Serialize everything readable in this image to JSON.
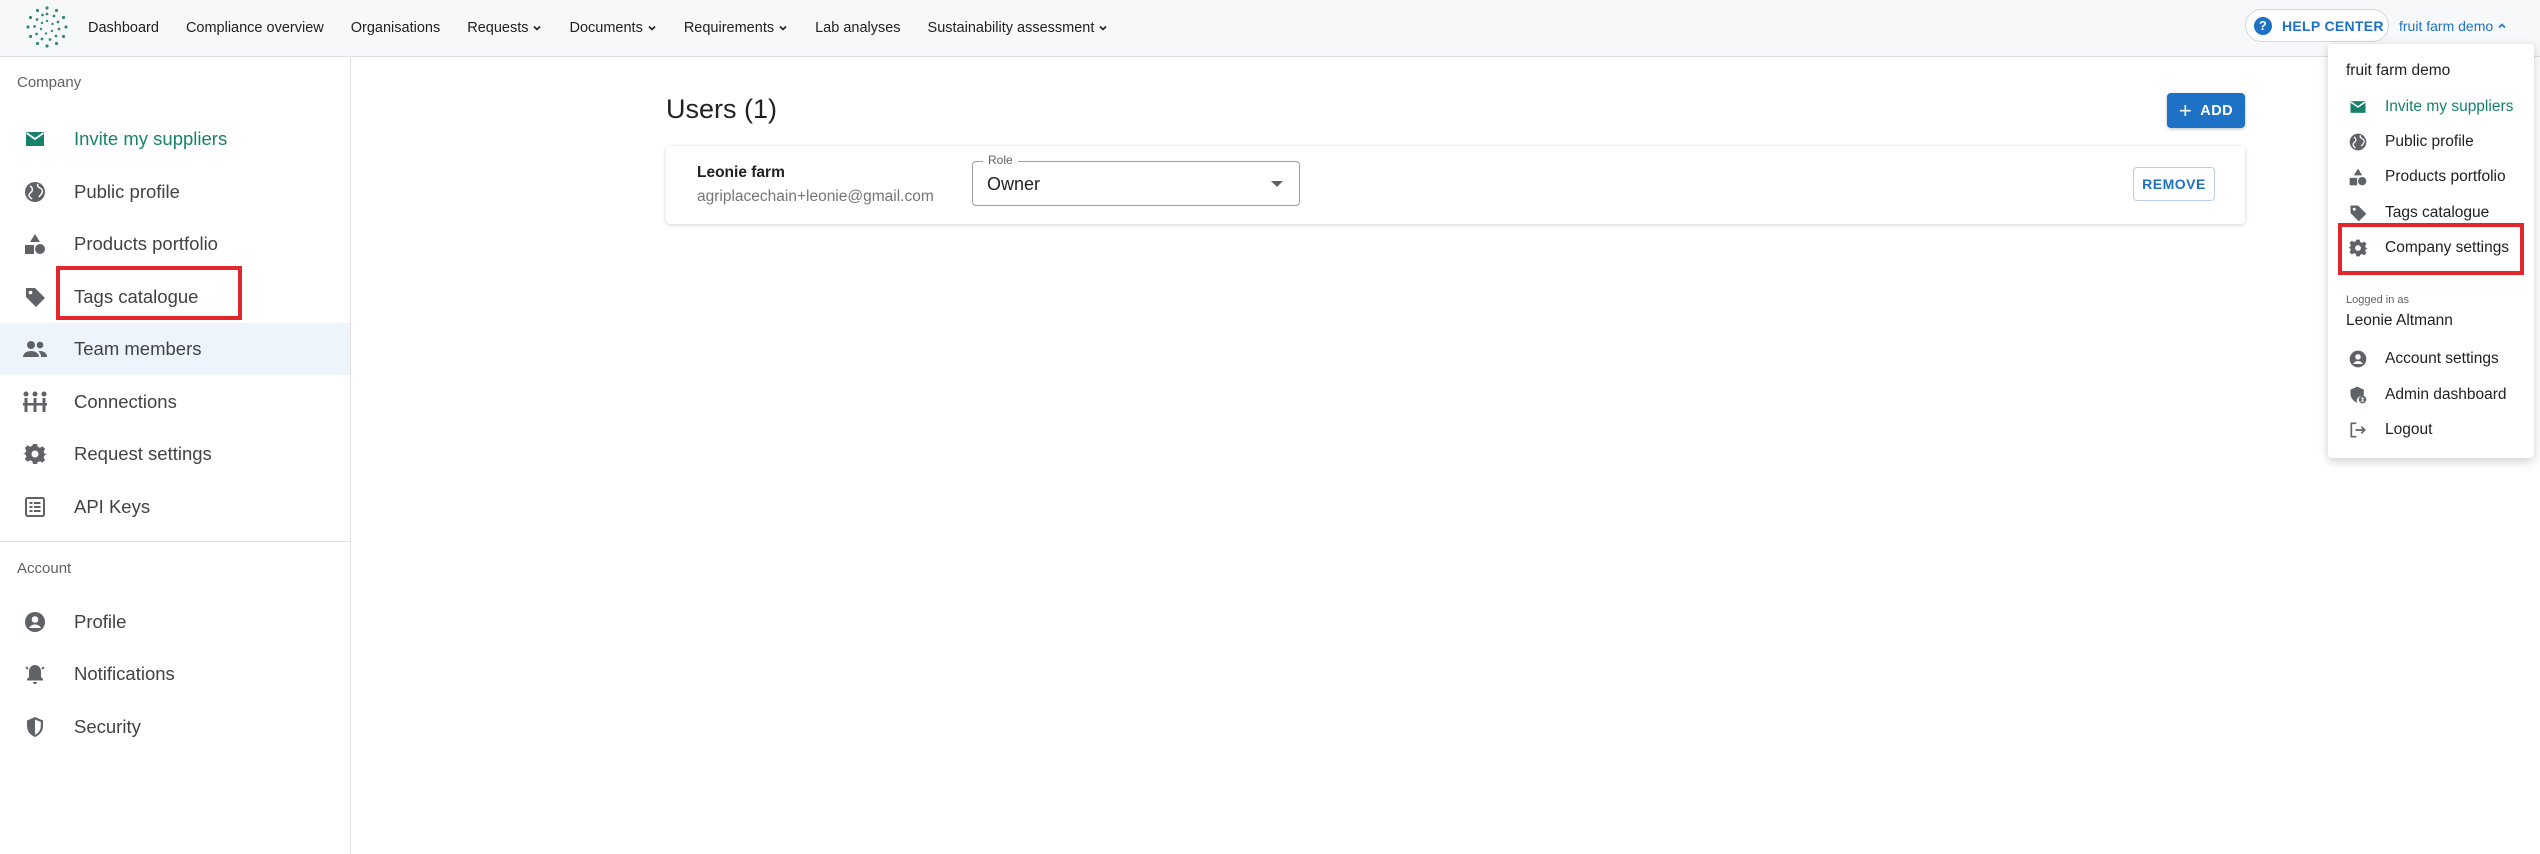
{
  "nav": {
    "items": [
      {
        "label": "Dashboard",
        "dropdown": false
      },
      {
        "label": "Compliance overview",
        "dropdown": false
      },
      {
        "label": "Organisations",
        "dropdown": false
      },
      {
        "label": "Requests",
        "dropdown": true
      },
      {
        "label": "Documents",
        "dropdown": true
      },
      {
        "label": "Requirements",
        "dropdown": true
      },
      {
        "label": "Lab analyses",
        "dropdown": false
      },
      {
        "label": "Sustainability assessment",
        "dropdown": true
      }
    ],
    "help_label": "HELP CENTER",
    "account_label": "fruit farm demo"
  },
  "sidebar": {
    "company_title": "Company",
    "account_title": "Account",
    "company_items": [
      {
        "label": "Invite my suppliers",
        "icon": "mail-icon"
      },
      {
        "label": "Public profile",
        "icon": "globe-icon"
      },
      {
        "label": "Products portfolio",
        "icon": "shapes-icon"
      },
      {
        "label": "Tags catalogue",
        "icon": "tag-icon"
      },
      {
        "label": "Team members",
        "icon": "people-icon"
      },
      {
        "label": "Connections",
        "icon": "connections-icon"
      },
      {
        "label": "Request settings",
        "icon": "gear-icon"
      },
      {
        "label": "API Keys",
        "icon": "api-keys-icon"
      }
    ],
    "account_items": [
      {
        "label": "Profile",
        "icon": "account-circle-icon"
      },
      {
        "label": "Notifications",
        "icon": "bell-icon"
      },
      {
        "label": "Security",
        "icon": "shield-icon"
      }
    ]
  },
  "main": {
    "title": "Users (1)",
    "add_label": "ADD",
    "user": {
      "name": "Leonie farm",
      "email": "agriplacechain+leonie@gmail.com",
      "role_label": "Role",
      "role_value": "Owner",
      "remove_label": "REMOVE"
    }
  },
  "dropdown": {
    "company_name": "fruit farm demo",
    "company_items": [
      {
        "label": "Invite my suppliers",
        "icon": "mail-icon"
      },
      {
        "label": "Public profile",
        "icon": "globe-icon"
      },
      {
        "label": "Products portfolio",
        "icon": "shapes-icon"
      },
      {
        "label": "Tags catalogue",
        "icon": "tag-icon"
      },
      {
        "label": "Company settings",
        "icon": "gear-icon"
      }
    ],
    "logged_in_label": "Logged in as",
    "user_name": "Leonie Altmann",
    "account_items": [
      {
        "label": "Account settings",
        "icon": "account-circle-icon"
      },
      {
        "label": "Admin dashboard",
        "icon": "admin-icon"
      },
      {
        "label": "Logout",
        "icon": "logout-icon"
      }
    ]
  },
  "colors": {
    "accent": "#1d72c6",
    "green": "#16826c",
    "highlight": "#e3262c"
  }
}
